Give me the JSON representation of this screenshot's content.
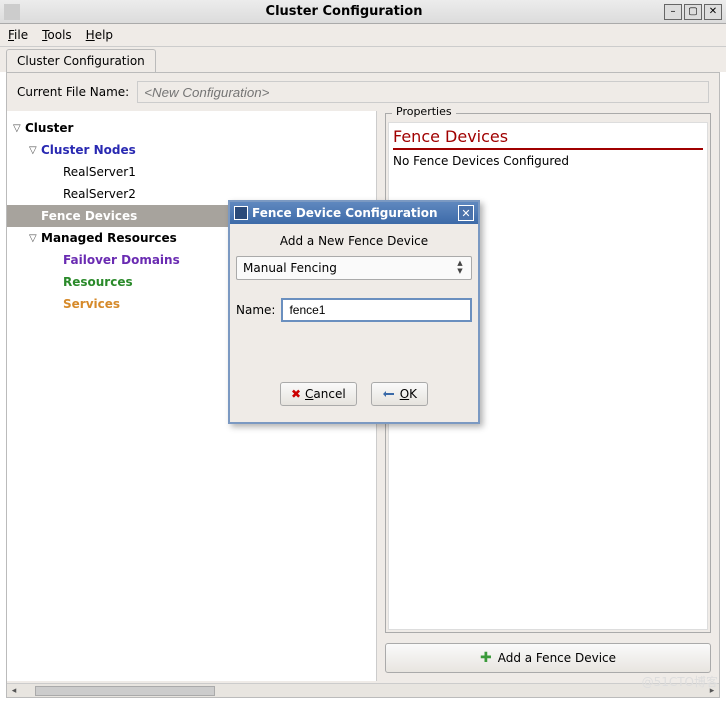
{
  "window": {
    "title": "Cluster Configuration"
  },
  "menubar": {
    "file": "File",
    "tools": "Tools",
    "help": "Help"
  },
  "tab": {
    "label": "Cluster Configuration"
  },
  "file_row": {
    "label": "Current File Name:",
    "placeholder": "<New Configuration>"
  },
  "tree": {
    "root": "Cluster",
    "nodes_label": "Cluster Nodes",
    "node1": "RealServer1",
    "node2": "RealServer2",
    "fence_label": "Fence Devices",
    "managed_label": "Managed Resources",
    "failover": "Failover Domains",
    "resources": "Resources",
    "services": "Services"
  },
  "properties": {
    "legend": "Properties",
    "title": "Fence Devices",
    "empty_msg": "No Fence Devices Configured",
    "add_button": "Add a Fence Device"
  },
  "dialog": {
    "title": "Fence Device Configuration",
    "heading": "Add a New Fence Device",
    "select_value": "Manual Fencing",
    "name_label": "Name:",
    "name_value": "fence1",
    "cancel": "Cancel",
    "ok": "OK"
  },
  "watermark": "@51CTO博客"
}
